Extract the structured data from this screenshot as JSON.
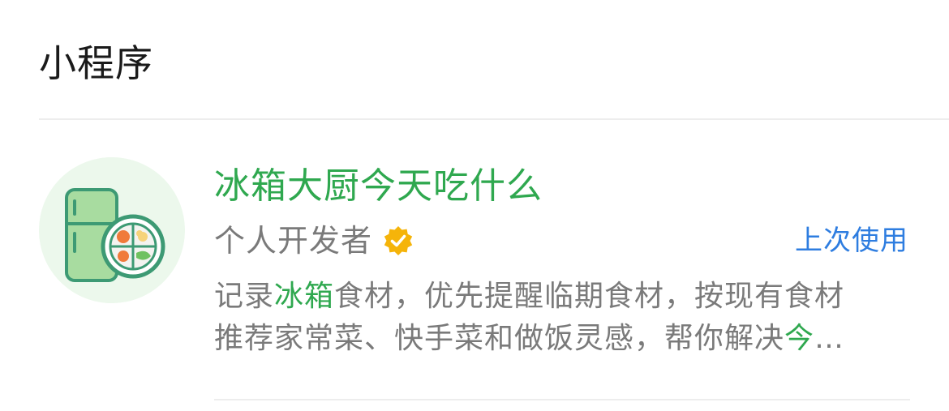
{
  "section": {
    "title": "小程序"
  },
  "result": {
    "name": "冰箱大厨今天吃什么",
    "developer": "个人开发者",
    "last_used": "上次使用",
    "description": {
      "line1": {
        "a": "记录",
        "hl": "冰箱",
        "b": "食材，优先提醒临期食材，按现有食材"
      },
      "line2": {
        "a": "推荐家常菜、快手菜和做饭灵感，帮你解决",
        "hl": "今",
        "ellipsis": "…"
      }
    }
  },
  "colors": {
    "accent_green": "#2fa84f",
    "link_blue": "#2e7de0",
    "secondary_text": "#7a7a7a",
    "verified_gold": "#f5b40a"
  },
  "icons": {
    "app": "fridge-and-plate-icon",
    "verified": "verified-badge-icon"
  }
}
